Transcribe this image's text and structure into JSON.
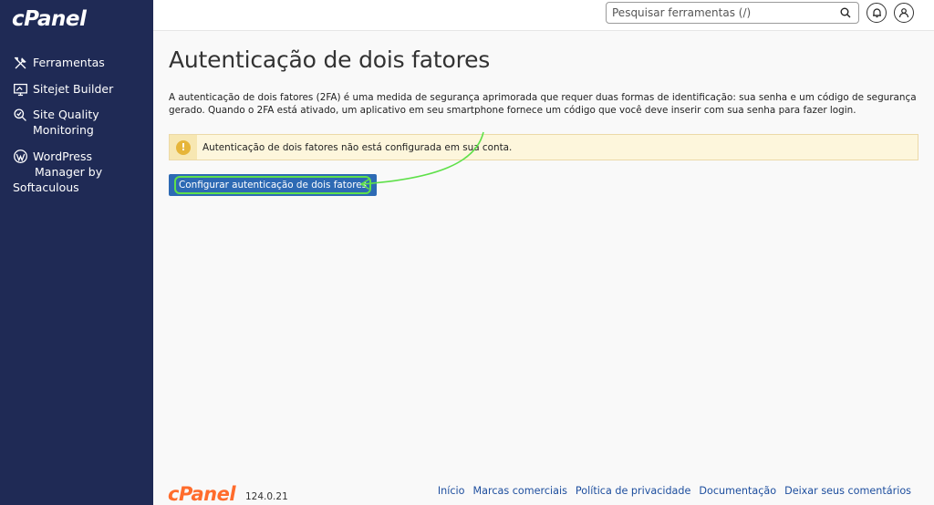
{
  "brand": {
    "logo": "cPanel",
    "version": "124.0.21"
  },
  "sidebar": {
    "items": [
      {
        "label": "Ferramentas",
        "icon": "tools-icon"
      },
      {
        "label": "Sitejet Builder",
        "icon": "sitejet-icon"
      },
      {
        "label_line1": "Site Quality",
        "label_line2": "Monitoring",
        "icon": "site-quality-icon"
      },
      {
        "label_line1": "WordPress",
        "label_line2": "Manager by",
        "label_line3": "Softaculous",
        "icon": "wordpress-icon"
      }
    ]
  },
  "header": {
    "search_placeholder": "Pesquisar ferramentas (/)"
  },
  "main": {
    "title": "Autenticação de dois fatores",
    "description": "A autenticação de dois fatores (2FA) é uma medida de segurança aprimorada que requer duas formas de identificação: sua senha e um código de segurança gerado. Quando o 2FA está ativado, um aplicativo em seu smartphone fornece um código que você deve inserir com sua senha para fazer login.",
    "alert_text": "Autenticação de dois fatores não está configurada em sua conta.",
    "config_button": "Configurar autenticação de dois fatores"
  },
  "footer": {
    "links": [
      "Início",
      "Marcas comerciais",
      "Política de privacidade",
      "Documentação",
      "Deixar seus comentários"
    ]
  },
  "colors": {
    "sidebar_bg": "#1f2a55",
    "accent_orange": "#ff6c2c",
    "button_blue": "#2d6ab4",
    "annotation_green": "#5fe04a",
    "alert_bg": "#fdf6dc"
  }
}
